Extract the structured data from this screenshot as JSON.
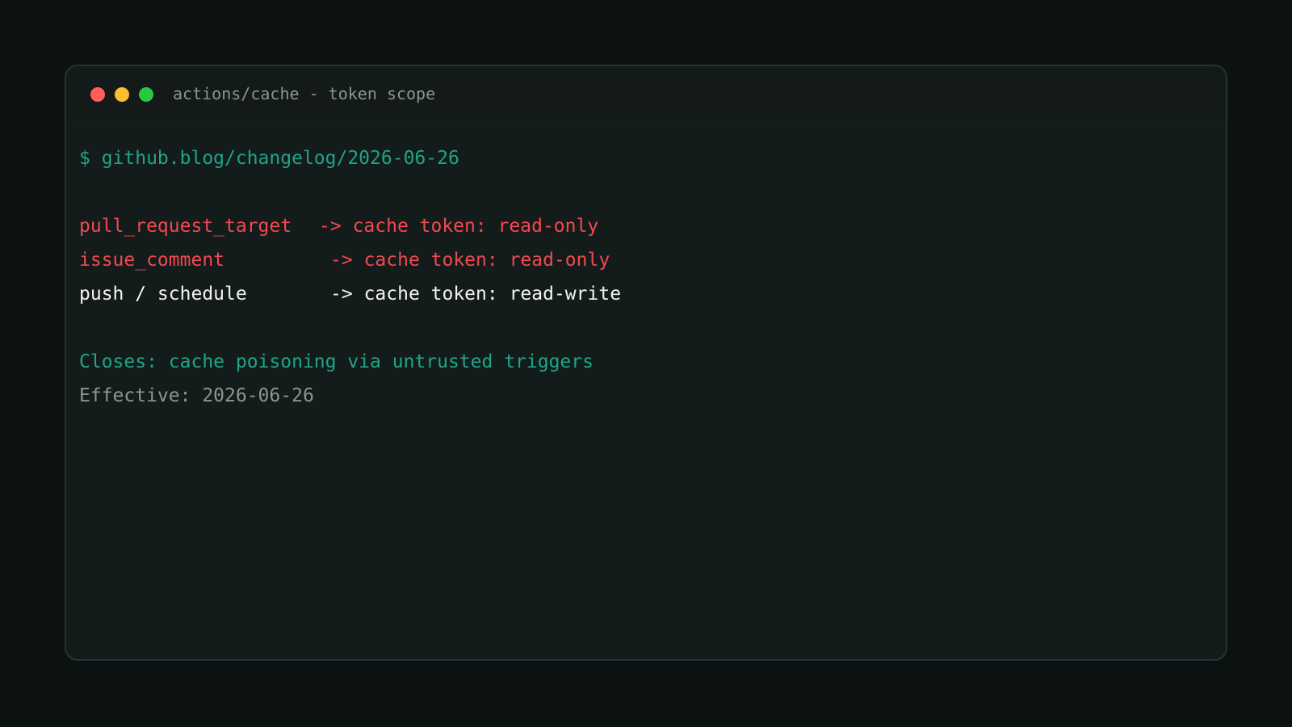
{
  "window": {
    "title": "actions/cache - token scope"
  },
  "terminal": {
    "command": "$ github.blog/changelog/2026-06-26",
    "rules": [
      {
        "trigger": "pull_request_target",
        "arrow": "->",
        "result": "cache token: read-only",
        "color": "#f0494f"
      },
      {
        "trigger": "issue_comment",
        "arrow": "->",
        "result": "cache token: read-only",
        "color": "#f0494f"
      },
      {
        "trigger": "push / schedule",
        "arrow": "->",
        "result": "cache token: read-write",
        "color": "#f2f4f3"
      }
    ],
    "closes": "Closes: cache poisoning via untrusted triggers",
    "effective": "Effective: 2026-06-26"
  },
  "colors": {
    "background": "#0c1212",
    "window": "#141c1b",
    "accent": "#1fa489",
    "danger": "#f0494f",
    "muted": "#8a9694",
    "text": "#f2f4f3"
  }
}
